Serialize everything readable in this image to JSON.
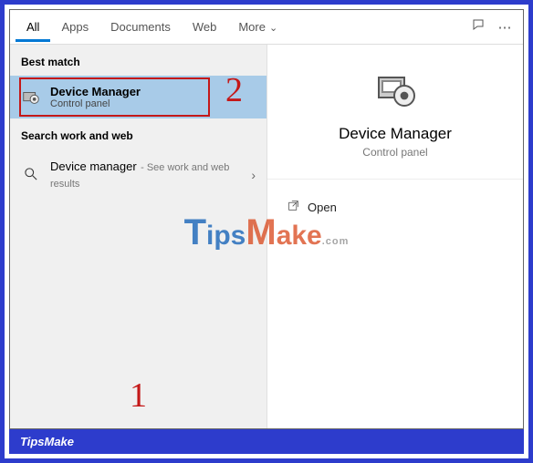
{
  "tabs": {
    "all": "All",
    "apps": "Apps",
    "documents": "Documents",
    "web": "Web",
    "more": "More"
  },
  "left": {
    "best_match_header": "Best match",
    "best_match": {
      "title": "Device Manager",
      "subtitle": "Control panel"
    },
    "search_header": "Search work and web",
    "web_result": {
      "title": "Device manager",
      "subtitle": "See work and web results"
    }
  },
  "preview": {
    "title": "Device Manager",
    "subtitle": "Control panel"
  },
  "actions": {
    "open": "Open"
  },
  "annotations": {
    "one": "1",
    "two": "2"
  },
  "watermark": {
    "part1": "ips",
    "part2": "ake",
    "suffix": ".com"
  },
  "footer": {
    "brand": "TipsMake"
  },
  "icons": {
    "device_manager": "device-manager-icon",
    "search": "search-icon",
    "chevron_right": "›",
    "open": "↗",
    "feedback": "feedback-icon",
    "more_h": "⋯"
  }
}
